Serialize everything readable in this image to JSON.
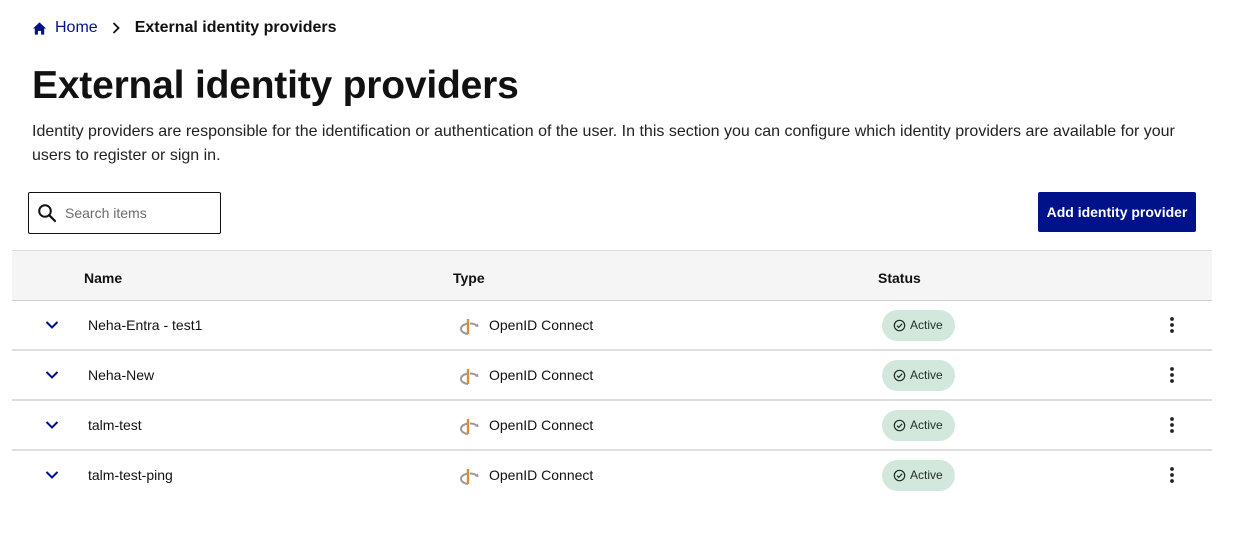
{
  "breadcrumb": {
    "home_label": "Home",
    "current_label": "External identity providers"
  },
  "page": {
    "title": "External identity providers",
    "description": "Identity providers are responsible for the identification or authentication of the user. In this section you can configure which identity providers are available for your users to register or sign in."
  },
  "search": {
    "placeholder": "Search items",
    "value": ""
  },
  "actions": {
    "add_label": "Add identity provider"
  },
  "table": {
    "columns": {
      "name": "Name",
      "type": "Type",
      "status": "Status"
    },
    "rows": [
      {
        "name": "Neha-Entra - test1",
        "type": "OpenID Connect",
        "status": "Active"
      },
      {
        "name": "Neha-New",
        "type": "OpenID Connect",
        "status": "Active"
      },
      {
        "name": "talm-test",
        "type": "OpenID Connect",
        "status": "Active"
      },
      {
        "name": "talm-test-ping",
        "type": "OpenID Connect",
        "status": "Active"
      }
    ]
  },
  "icons": {
    "home": "home-icon",
    "breadcrumb_separator": "chevron-right-icon",
    "search": "search-icon",
    "expand": "chevron-down-icon",
    "provider_type": "openid-icon",
    "status": "check-circle-icon",
    "row_menu": "more-vertical-icon"
  },
  "colors": {
    "primary": "#00128a",
    "status_active_bg": "#d3e8dc",
    "openid_orange": "#e38b2c",
    "openid_gray": "#9a9a9a"
  }
}
